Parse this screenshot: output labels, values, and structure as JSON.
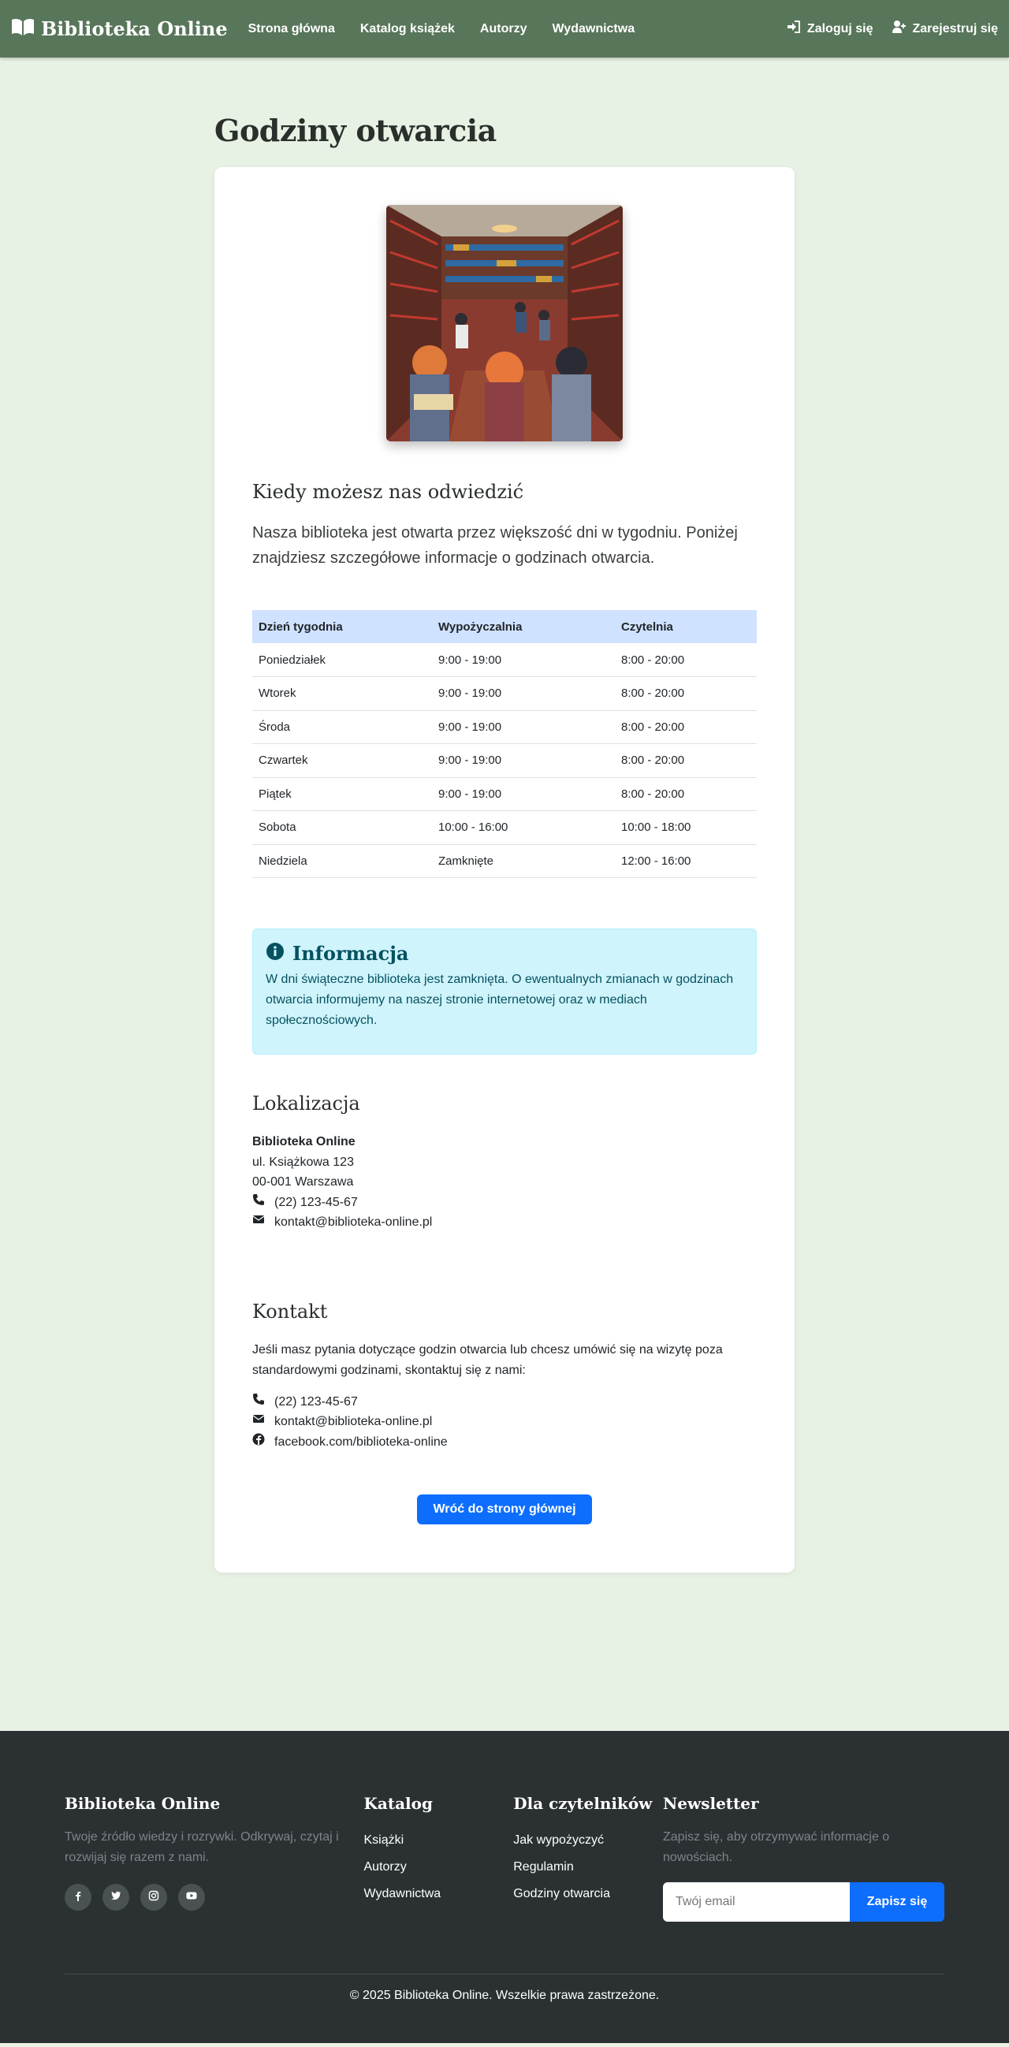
{
  "navbar": {
    "brand": "Biblioteka Online",
    "links": [
      "Strona główna",
      "Katalog książek",
      "Autorzy",
      "Wydawnictwa"
    ],
    "login": "Zaloguj się",
    "register": "Zarejestruj się"
  },
  "page": {
    "title": "Godziny otwarcia",
    "visit_heading": "Kiedy możesz nas odwiedzić",
    "lead": "Nasza biblioteka jest otwarta przez większość dni w tygodniu. Poniżej znajdziesz szczegółowe informacje o godzinach otwarcia."
  },
  "hours": {
    "headers": [
      "Dzień tygodnia",
      "Wypożyczalnia",
      "Czytelnia"
    ],
    "rows": [
      [
        "Poniedziałek",
        "9:00 - 19:00",
        "8:00 - 20:00"
      ],
      [
        "Wtorek",
        "9:00 - 19:00",
        "8:00 - 20:00"
      ],
      [
        "Środa",
        "9:00 - 19:00",
        "8:00 - 20:00"
      ],
      [
        "Czwartek",
        "9:00 - 19:00",
        "8:00 - 20:00"
      ],
      [
        "Piątek",
        "9:00 - 19:00",
        "8:00 - 20:00"
      ],
      [
        "Sobota",
        "10:00 - 16:00",
        "10:00 - 18:00"
      ],
      [
        "Niedziela",
        "Zamknięte",
        "12:00 - 16:00"
      ]
    ]
  },
  "info": {
    "title": "Informacja",
    "text": "W dni świąteczne biblioteka jest zamknięta. O ewentualnych zmianach w godzinach otwarcia informujemy na naszej stronie internetowej oraz w mediach społecznościowych."
  },
  "location": {
    "heading": "Lokalizacja",
    "name": "Biblioteka Online",
    "street": "ul. Książkowa 123",
    "city": "00-001 Warszawa",
    "phone": "(22) 123-45-67",
    "email": "kontakt@biblioteka-online.pl"
  },
  "contact": {
    "heading": "Kontakt",
    "text": "Jeśli masz pytania dotyczące godzin otwarcia lub chcesz umówić się na wizytę poza standardowymi godzinami, skontaktuj się z nami:",
    "phone": "(22) 123-45-67",
    "email": "kontakt@biblioteka-online.pl",
    "facebook": "facebook.com/biblioteka-online"
  },
  "back_button": "Wróć do strony głównej",
  "footer": {
    "about_title": "Biblioteka Online",
    "about_text": "Twoje źródło wiedzy i rozrywki. Odkrywaj, czytaj i rozwijaj się razem z nami.",
    "catalog_title": "Katalog",
    "catalog_links": [
      "Książki",
      "Autorzy",
      "Wydawnictwa"
    ],
    "readers_title": "Dla czytelników",
    "readers_links": [
      "Jak wypożyczyć",
      "Regulamin",
      "Godziny otwarcia"
    ],
    "newsletter_title": "Newsletter",
    "newsletter_text": "Zapisz się, aby otrzymywać informacje o nowościach.",
    "newsletter_placeholder": "Twój email",
    "newsletter_button": "Zapisz się",
    "copyright": "© 2025 Biblioteka Online. Wszelkie prawa zastrzeżone."
  },
  "colors": {
    "navbar": "#58765a",
    "page_bg": "#e7f1e4",
    "primary": "#0d6efd",
    "footer": "#2b3132",
    "info_bg": "#cff4fc"
  }
}
